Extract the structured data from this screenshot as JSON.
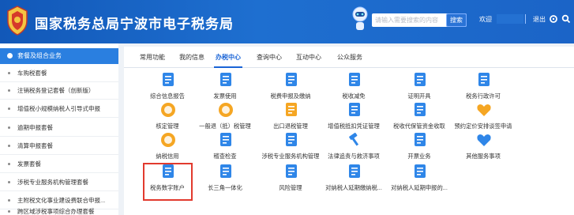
{
  "header": {
    "title": "国家税务总局宁波市电子税务局",
    "search_placeholder": "请输入需要搜索的内容",
    "search_button": "搜索",
    "welcome": "欢迎",
    "logout": "退出"
  },
  "sidebar": {
    "heading": "套餐及组合业务",
    "items": [
      {
        "label": "车购税套餐"
      },
      {
        "label": "注销税务登记套餐（创新版）"
      },
      {
        "label": "增值税小规模纳税人引导式申报"
      },
      {
        "label": "逾期申报套餐"
      },
      {
        "label": "清算申报套餐"
      },
      {
        "label": "发票套餐"
      },
      {
        "label": "涉税专业服务机构管理套餐"
      },
      {
        "label": "主附税文化事业建设费联合申报..."
      },
      {
        "label": "跨区域涉税事项综合办理套餐"
      }
    ]
  },
  "tabs": [
    {
      "label": "常用功能"
    },
    {
      "label": "我的信息"
    },
    {
      "label": "办税中心"
    },
    {
      "label": "查询中心"
    },
    {
      "label": "互动中心"
    },
    {
      "label": "公众服务"
    }
  ],
  "active_tab_index": 2,
  "services": [
    {
      "label": "综合信息报告",
      "icon": "report-icon",
      "color": "#2f86e8"
    },
    {
      "label": "发票使用",
      "icon": "invoice-icon",
      "color": "#2f86e8"
    },
    {
      "label": "税费申报及缴纳",
      "icon": "tax-pay-icon",
      "color": "#2f86e8"
    },
    {
      "label": "税收减免",
      "icon": "tax-relief-icon",
      "color": "#2f86e8"
    },
    {
      "label": "证明开具",
      "icon": "certificate-icon",
      "color": "#2f86e8"
    },
    {
      "label": "税务行政许可",
      "icon": "permit-icon",
      "color": "#2f86e8"
    },
    {
      "label": "核定管理",
      "icon": "verify-icon",
      "color": "#f5a623"
    },
    {
      "label": "一般退（抵）税管理",
      "icon": "refund-icon",
      "color": "#f5a623"
    },
    {
      "label": "出口退税管理",
      "icon": "export-refund-icon",
      "color": "#f5a623"
    },
    {
      "label": "增值税抵扣凭证管理",
      "icon": "deduction-icon",
      "color": "#2f86e8"
    },
    {
      "label": "税收代保管资金收取",
      "icon": "custody-icon",
      "color": "#2f86e8"
    },
    {
      "label": "预约定价安排谈签申请",
      "icon": "pricing-icon",
      "color": "#f5a623"
    },
    {
      "label": "纳税信用",
      "icon": "credit-icon",
      "color": "#f5a623"
    },
    {
      "label": "稽查检查",
      "icon": "inspection-icon",
      "color": "#2f86e8"
    },
    {
      "label": "涉税专业服务机构管理",
      "icon": "agency-icon",
      "color": "#2f86e8"
    },
    {
      "label": "法律追责与救济事项",
      "icon": "gavel-icon",
      "color": "#2f86e8"
    },
    {
      "label": "开票业务",
      "icon": "billing-icon",
      "color": "#2f86e8"
    },
    {
      "label": "其他服务事项",
      "icon": "heart-icon",
      "color": "#2f86e8"
    },
    {
      "label": "税务数字账户",
      "icon": "digital-account-icon",
      "color": "#2f86e8"
    },
    {
      "label": "长三角一体化",
      "icon": "delta-icon",
      "color": "#2f86e8"
    },
    {
      "label": "风险管理",
      "icon": "risk-icon",
      "color": "#2f86e8"
    },
    {
      "label": "对纳税人延期缴纳税...",
      "icon": "defer-pay-icon",
      "color": "#2f86e8"
    },
    {
      "label": "对纳税人延期申报的...",
      "icon": "defer-declare-icon",
      "color": "#2f86e8"
    }
  ]
}
